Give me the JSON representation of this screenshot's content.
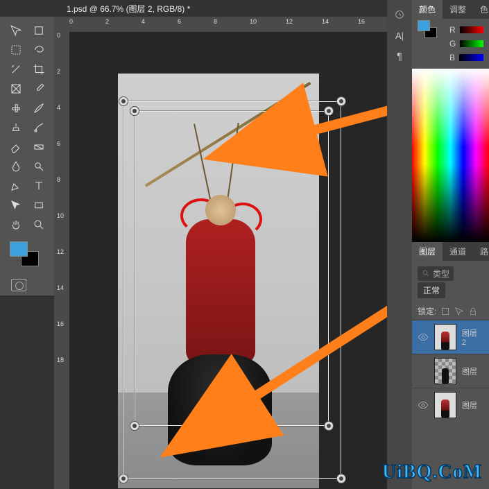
{
  "document": {
    "tab_title": "1.psd @ 66.7% (图层 2, RGB/8) *"
  },
  "tools": {
    "move": "move-tool",
    "artboard": "artboard-tool",
    "marquee": "rectangular-marquee-tool",
    "lasso": "lasso-tool",
    "wand": "magic-wand-tool",
    "crop": "crop-tool",
    "frame": "frame-tool",
    "eyedropper": "eyedropper-tool",
    "patch": "spot-healing-tool",
    "brush": "brush-tool",
    "stamp": "clone-stamp-tool",
    "history": "history-brush-tool",
    "eraser": "eraser-tool",
    "gradient": "gradient-tool",
    "blur": "blur-tool",
    "dodge": "dodge-tool",
    "pen": "pen-tool",
    "type": "horizontal-type-tool",
    "pathsel": "path-selection-tool",
    "shape": "rectangle-tool",
    "hand": "hand-tool",
    "zoom": "zoom-tool"
  },
  "fg_color": "#3ca0dc",
  "ruler_h": [
    "0",
    "2",
    "4",
    "6",
    "8",
    "10",
    "12",
    "14",
    "16"
  ],
  "ruler_v": [
    "0",
    "2",
    "4",
    "6",
    "8",
    "10",
    "12",
    "14",
    "16",
    "18"
  ],
  "side_icons": [
    "history-icon",
    "character-icon",
    "paragraph-icon"
  ],
  "color_panel": {
    "tabs": [
      "颜色",
      "调整",
      "色"
    ],
    "channels": [
      "R",
      "G",
      "B"
    ],
    "fg": "#3ca0dc"
  },
  "layers_panel": {
    "tabs": [
      "图层",
      "通道",
      "路"
    ],
    "search_placeholder": "类型",
    "blend_mode": "正常",
    "lock_label": "锁定:",
    "layers": [
      {
        "visible": true,
        "name": "图层 2",
        "thumb": "statue",
        "active": true
      },
      {
        "visible": false,
        "name": "图层",
        "thumb": "silhouette",
        "active": false
      },
      {
        "visible": true,
        "name": "图层",
        "thumb": "statue",
        "active": false
      }
    ]
  },
  "watermark": "UiBQ.CoM"
}
